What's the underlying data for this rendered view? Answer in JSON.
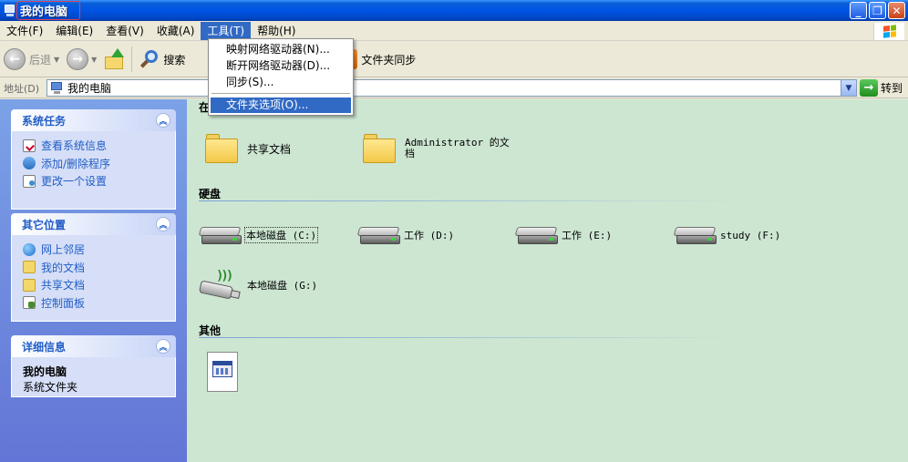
{
  "window": {
    "title": "我的电脑"
  },
  "menubar": {
    "items": [
      {
        "label": "文件(F)"
      },
      {
        "label": "编辑(E)"
      },
      {
        "label": "查看(V)"
      },
      {
        "label": "收藏(A)"
      },
      {
        "label": "工具(T)",
        "active": true
      },
      {
        "label": "帮助(H)"
      }
    ]
  },
  "toolbar": {
    "back_label": "后退",
    "search_label": "搜索",
    "sync_label": "文件夹同步"
  },
  "addressbar": {
    "label": "地址(D)",
    "value": "我的电脑",
    "go_label": "转到"
  },
  "tools_menu": {
    "items": [
      {
        "label": "映射网络驱动器(N)..."
      },
      {
        "label": "断开网络驱动器(D)..."
      },
      {
        "label": "同步(S)..."
      },
      {
        "label": "文件夹选项(O)...",
        "highlighted": true
      }
    ]
  },
  "left_panel": {
    "system_tasks": {
      "title": "系统任务",
      "items": [
        {
          "label": "查看系统信息",
          "icon": "system-info-icon"
        },
        {
          "label": "添加/删除程序",
          "icon": "add-remove-icon"
        },
        {
          "label": "更改一个设置",
          "icon": "control-setting-icon"
        }
      ]
    },
    "other_places": {
      "title": "其它位置",
      "items": [
        {
          "label": "网上邻居",
          "icon": "network-icon"
        },
        {
          "label": "我的文档",
          "icon": "documents-folder-icon"
        },
        {
          "label": "共享文档",
          "icon": "shared-folder-icon"
        },
        {
          "label": "控制面板",
          "icon": "control-panel-icon"
        }
      ]
    },
    "details": {
      "title": "详细信息",
      "name": "我的电脑",
      "type": "系统文件夹"
    }
  },
  "main": {
    "groups": {
      "stored_title": "在",
      "drives_title": "硬盘",
      "other_title": "其他"
    },
    "folders": [
      {
        "label": "共享文档"
      },
      {
        "label": "Administrator 的文档"
      }
    ],
    "drives": [
      {
        "label": "本地磁盘 (C:)",
        "selected": true
      },
      {
        "label": "工作 (D:)"
      },
      {
        "label": "工作 (E:)"
      },
      {
        "label": "study (F:)"
      },
      {
        "label": "本地磁盘 (G:)",
        "removable": true
      }
    ]
  },
  "colors": {
    "titlebar": "#0054e3",
    "menu_highlight": "#316ac5",
    "left_panel": "#6375d6",
    "content_bg": "#cde6d2",
    "task_link": "#215dc6"
  }
}
